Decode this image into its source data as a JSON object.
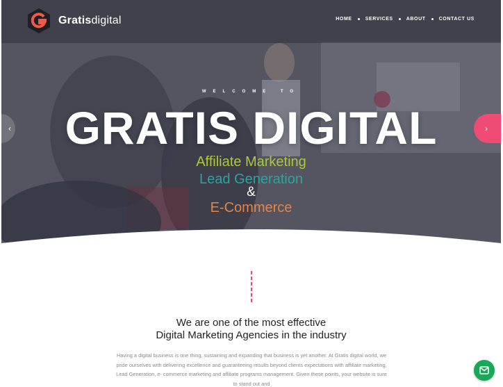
{
  "brand": {
    "name_bold": "Gratis",
    "name_light": "digital"
  },
  "nav": {
    "items": [
      "HOME",
      "SERVICES",
      "ABOUT",
      "CONTACT US"
    ]
  },
  "hero": {
    "welcome": "WELCOME TO",
    "title": "GRATIS DIGITAL",
    "lines": [
      "Affiliate Marketing",
      "Lead Generation",
      "&",
      "E-Commerce"
    ],
    "arrow_left": "‹",
    "arrow_right": "›"
  },
  "intro": {
    "heading_line1": "We are one of the most effective",
    "heading_line2": "Digital Marketing Agencies in the industry",
    "paragraph": "Having a digital business is one thing, sustaining and expanding that business is yet another. At Gratis digital world, we pride ourselves with delivering excellence and guaranteeing results beyond clients expectations with affiliate marketing, Lead Generation, e- commerce marketing and affiliate programs management. Given these points, your website is sure to stand out and"
  },
  "colors": {
    "accent_pink": "#ef4b73",
    "green": "#a9c93a",
    "teal": "#2aa5a0",
    "orange": "#e2854a",
    "chat_green": "#18a85a"
  },
  "icons": [
    "logo-g-icon",
    "chevron-left-icon",
    "chevron-right-icon",
    "mouse-scroll-icon",
    "chat-mail-icon"
  ]
}
